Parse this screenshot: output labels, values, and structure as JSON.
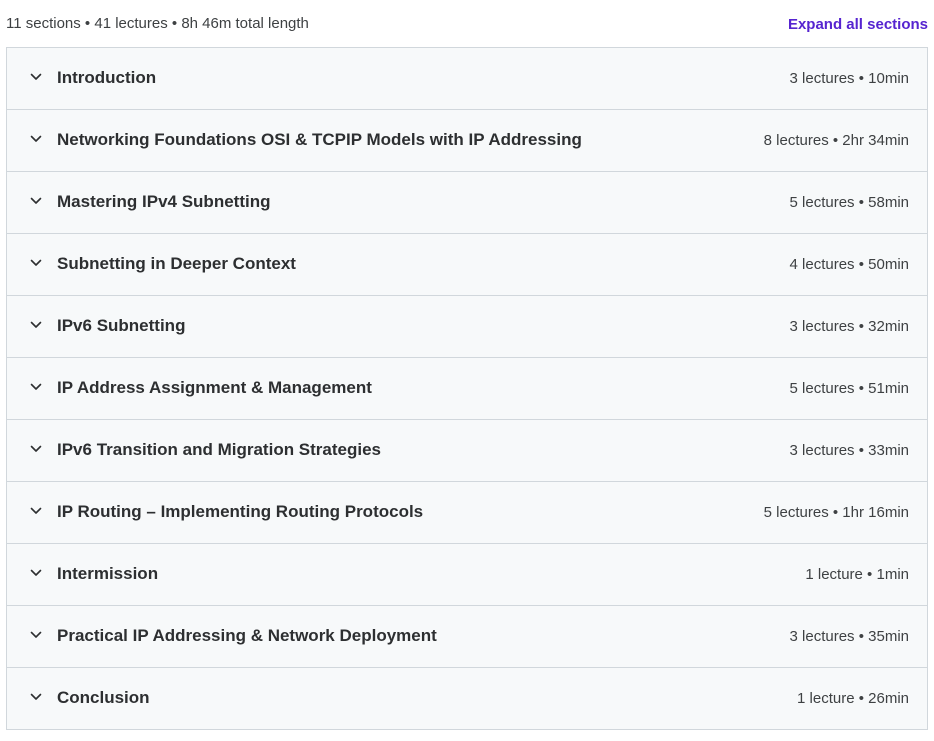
{
  "summary": {
    "text": "11 sections • 41 lectures • 8h 46m total length",
    "expand_label": "Expand all sections"
  },
  "colors": {
    "accent": "#5624d0",
    "row_bg": "#f7f9fa",
    "border": "#d1d7dc",
    "text": "#2d2f31"
  },
  "sections": [
    {
      "title": "Introduction",
      "meta": "3 lectures • 10min",
      "icon": "chevron-down-icon"
    },
    {
      "title": "Networking Foundations OSI & TCPIP Models with IP Addressing",
      "meta": "8 lectures • 2hr 34min",
      "icon": "chevron-down-icon"
    },
    {
      "title": "Mastering IPv4 Subnetting",
      "meta": "5 lectures • 58min",
      "icon": "chevron-down-icon"
    },
    {
      "title": "Subnetting in Deeper Context",
      "meta": "4 lectures • 50min",
      "icon": "chevron-down-icon"
    },
    {
      "title": "IPv6 Subnetting",
      "meta": "3 lectures • 32min",
      "icon": "chevron-down-icon"
    },
    {
      "title": "IP Address Assignment & Management",
      "meta": "5 lectures • 51min",
      "icon": "chevron-down-icon"
    },
    {
      "title": "IPv6 Transition and Migration Strategies",
      "meta": "3 lectures • 33min",
      "icon": "chevron-down-icon"
    },
    {
      "title": "IP Routing – Implementing Routing Protocols",
      "meta": "5 lectures • 1hr 16min",
      "icon": "chevron-down-icon"
    },
    {
      "title": "Intermission",
      "meta": "1 lecture • 1min",
      "icon": "chevron-down-icon"
    },
    {
      "title": "Practical IP Addressing & Network Deployment",
      "meta": "3 lectures • 35min",
      "icon": "chevron-down-icon"
    },
    {
      "title": "Conclusion",
      "meta": "1 lecture • 26min",
      "icon": "chevron-down-icon"
    }
  ]
}
